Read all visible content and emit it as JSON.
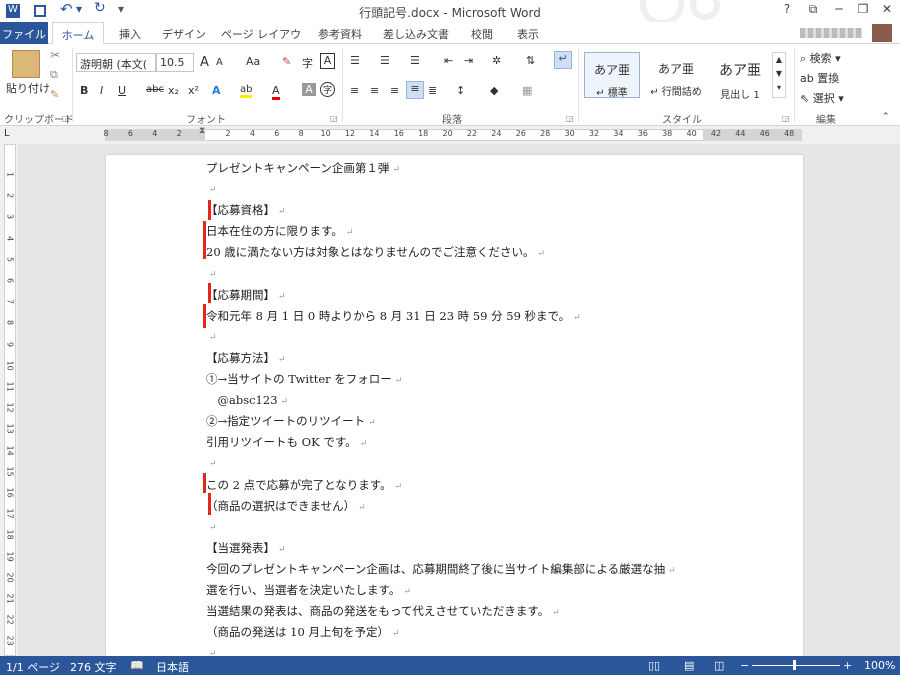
{
  "window": {
    "title": "行頭記号.docx - Microsoft Word",
    "help": "?",
    "min": "─",
    "restore": "❐",
    "close": "✕",
    "ribbon_opts": "⧉"
  },
  "quick_access": {
    "undo": "↶",
    "redo": "↻",
    "dropdown": "▾"
  },
  "tabs": [
    "ファイル",
    "ホーム",
    "挿入",
    "デザイン",
    "ページ レイアウト",
    "参考資料",
    "差し込み文書",
    "校閲",
    "表示"
  ],
  "ribbon": {
    "clipboard": {
      "paste": "貼り付け",
      "label": "クリップボード"
    },
    "font": {
      "name": "游明朝 (本文(",
      "size": "10.5",
      "label": "フォント",
      "grow": "A",
      "shrink": "A",
      "case": "Aa",
      "bold": "B",
      "italic": "I",
      "underline": "U",
      "strike": "abc",
      "sub": "x₂",
      "sup": "x²",
      "color": "A",
      "hilite": "ab",
      "char_shade": "A",
      "phonetic": "字",
      "enclosed": "A"
    },
    "paragraph": {
      "label": "段落"
    },
    "styles": {
      "label": "スタイル",
      "items": [
        {
          "glyph": "あア亜",
          "name": "↵ 標準"
        },
        {
          "glyph": "あア亜",
          "name": "↵ 行間詰め"
        },
        {
          "glyph": "あア亜",
          "name": "見出し 1"
        }
      ]
    },
    "editing": {
      "label": "編集",
      "find": "検索",
      "replace": "置換",
      "select": "選択"
    }
  },
  "ruler_numbers": [
    "8",
    "6",
    "4",
    "2",
    "",
    "2",
    "4",
    "6",
    "8",
    "10",
    "12",
    "14",
    "16",
    "18",
    "20",
    "22",
    "24",
    "26",
    "28",
    "30",
    "32",
    "34",
    "36",
    "38",
    "40",
    "42",
    "44",
    "46",
    "48"
  ],
  "vruler_numbers": [
    "1",
    "2",
    "3",
    "4",
    "5",
    "6",
    "7",
    "8",
    "9",
    "10",
    "11",
    "12",
    "13",
    "14",
    "15",
    "16",
    "17",
    "18",
    "19",
    "20",
    "21",
    "22",
    "23"
  ],
  "document": {
    "lines": [
      "プレゼントキャンペーン企画第１弾",
      "",
      "【応募資格】",
      "日本在住の方に限ります。",
      "20 歳に満たない方は対象とはなりませんのでご注意ください。",
      "",
      "【応募期間】",
      "令和元年 8 月 1 日 0 時よりから 8 月 31 日 23 時 59 分 59 秒まで。",
      "",
      "【応募方法】",
      "①→当サイトの Twitter をフォロー",
      "　@absc123",
      "②→指定ツイートのリツイート",
      "引用リツイートも OK です。",
      "",
      "この 2 点で応募が完了となります。",
      "（商品の選択はできません）",
      "",
      "【当選発表】",
      "今回のプレゼントキャンペーン企画は、応募期間終了後に当サイト編集部による厳選な抽",
      "選を行い、当選者を決定いたします。",
      "当選結果の発表は、商品の発送をもって代えさせていただきます。",
      "（商品の発送は 10 月上旬を予定）",
      ""
    ],
    "paragraph_mark": "↵"
  },
  "status": {
    "page": "1/1 ページ",
    "words": "276 文字",
    "lang": "日本語",
    "zoom": "100%"
  },
  "colors": {
    "accent": "#2b579a",
    "marker": "#e8251b"
  }
}
